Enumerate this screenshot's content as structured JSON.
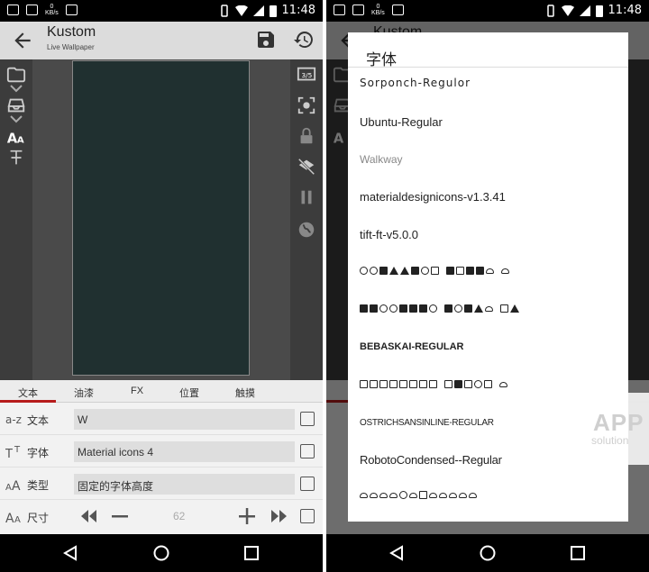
{
  "status_bar": {
    "time": "11:48",
    "data_rate": "0",
    "data_unit": "KB/s"
  },
  "app": {
    "title": "Kustom",
    "subtitle": "Live Wallpaper"
  },
  "right_rail": {
    "counter": "3/5"
  },
  "editor_tabs": [
    "文本",
    "油漆",
    "FX",
    "位置",
    "触摸"
  ],
  "properties": [
    {
      "label": "文本",
      "value": "W",
      "icon": "az-icon"
    },
    {
      "label": "字体",
      "value": "Material icons 4",
      "icon": "font-tt-icon"
    },
    {
      "label": "类型",
      "value": "固定的字体高度",
      "icon": "font-aa-icon"
    }
  ],
  "size_row": {
    "label": "尺寸",
    "value": "62"
  },
  "font_dialog": {
    "title": "字体",
    "fonts": [
      "Sorponch-Regulor",
      "Ubuntu-Regular",
      "Walkway",
      "materialdesignicons-v1.3.41",
      "tift-ft-v5.0.0",
      "BEBASKAI-REGULAR",
      "OSTRICHSANSINLINE-REGULAR",
      "RobotoCondensed--Regular"
    ]
  },
  "watermark": {
    "line1": "APP",
    "line2": "solution"
  },
  "colors": {
    "accent": "#b71c1c",
    "canvas": "#203030",
    "rail": "#3c3c3c"
  }
}
